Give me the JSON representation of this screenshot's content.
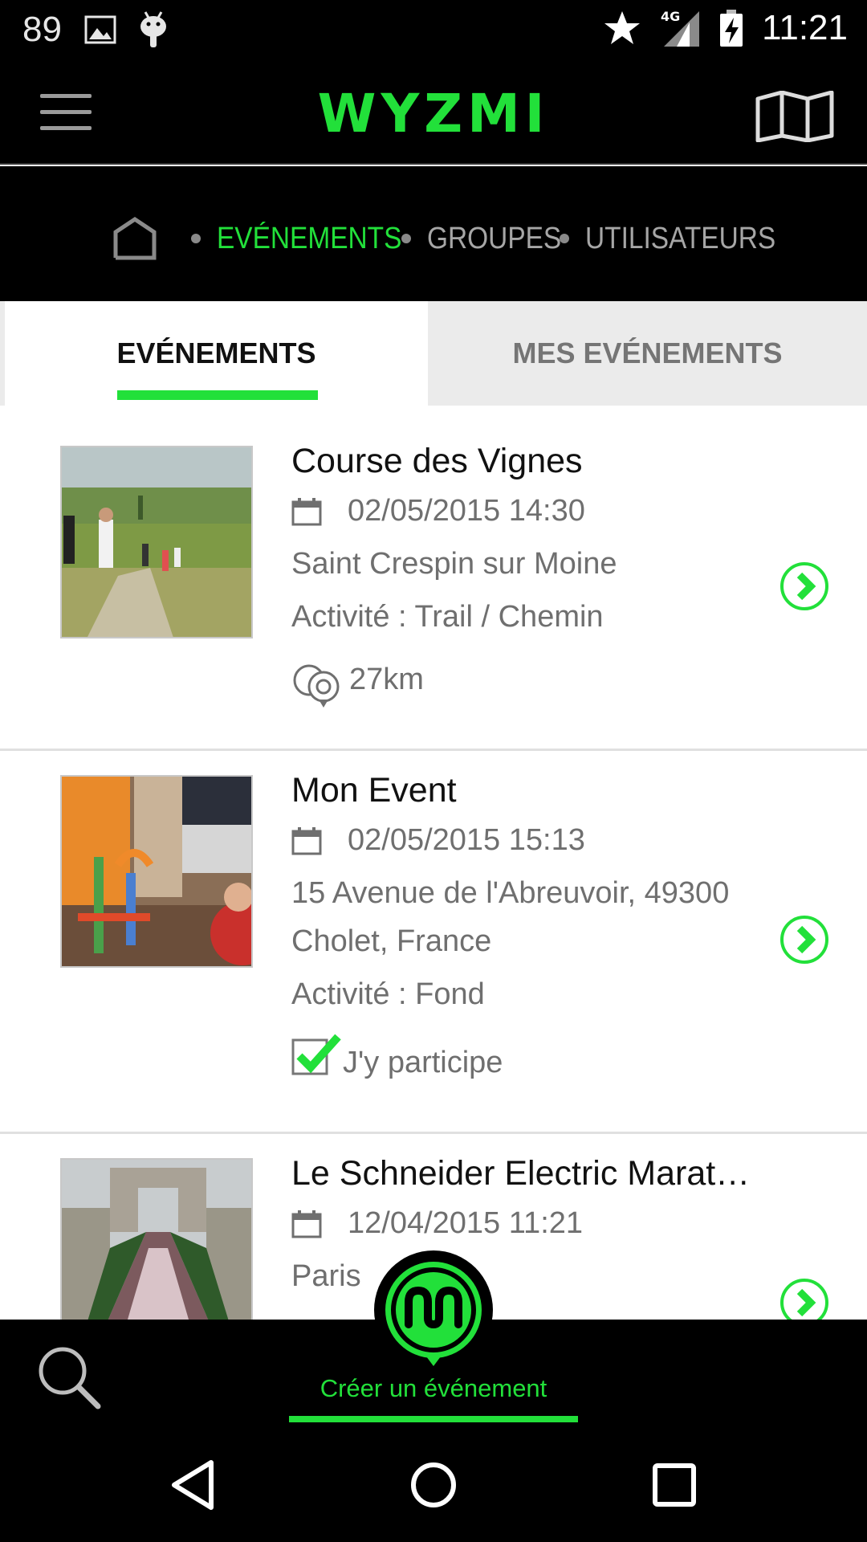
{
  "status_bar": {
    "notification_count": "89",
    "network": "4G",
    "time": "11:21",
    "icons": [
      "image-icon",
      "android-icon",
      "star-icon",
      "signal-icon",
      "battery-charging-icon"
    ]
  },
  "app_bar": {
    "logo": "WYZMI",
    "menu_icon": "hamburger-menu-icon",
    "map_icon": "map-icon"
  },
  "breadcrumb": {
    "home_icon": "home-icon",
    "items": [
      {
        "label": "EVÉNEMENTS",
        "active": true
      },
      {
        "label": "GROUPES",
        "active": false
      },
      {
        "label": "UTILISATEURS",
        "active": false
      }
    ]
  },
  "tabs": [
    {
      "label": "EVÉNEMENTS",
      "selected": true
    },
    {
      "label": "MES EVÉNEMENTS",
      "selected": false
    }
  ],
  "events": [
    {
      "title": "Course des Vignes",
      "date": "02/05/2015 14:30",
      "location": "Saint Crespin sur Moine",
      "activity": "Activité : Trail / Chemin",
      "distance": "27km"
    },
    {
      "title": "Mon Event",
      "date": "02/05/2015 15:13",
      "location_line1": "15 Avenue de l'Abreuvoir, 49300",
      "location_line2": "Cholet, France",
      "activity": "Activité : Fond",
      "participation": "J'y participe"
    },
    {
      "title": "Le Schneider Electric Marat…",
      "date": "12/04/2015 11:21",
      "location": "Paris"
    }
  ],
  "bottom_bar": {
    "create_label": "Créer un événement",
    "search_icon": "search-icon"
  },
  "colors": {
    "accent": "#22e03a",
    "bar_background": "#000000",
    "secondary_text": "#6f6f6f"
  }
}
